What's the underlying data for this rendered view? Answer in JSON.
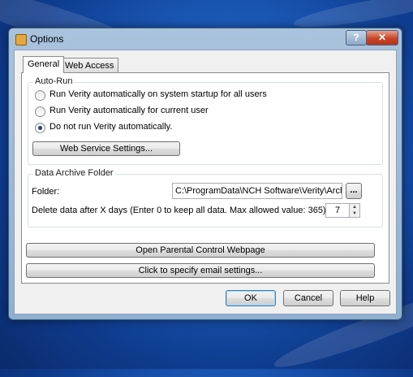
{
  "window": {
    "title": "Options",
    "help_label": "?",
    "close_label": "✕"
  },
  "tabs": [
    {
      "label": "General"
    },
    {
      "label": "Web Access"
    }
  ],
  "auto_run": {
    "title": "Auto-Run",
    "options": [
      {
        "label": "Run Verity automatically on system startup for all users",
        "checked": false
      },
      {
        "label": "Run Verity automatically for current user",
        "checked": false
      },
      {
        "label": "Do not run Verity automatically.",
        "checked": true
      }
    ],
    "web_service_button": "Web Service Settings..."
  },
  "archive": {
    "title": "Data Archive Folder",
    "folder_label": "Folder:",
    "folder_value": "C:\\ProgramData\\NCH Software\\Verity\\Archive",
    "browse_label": "...",
    "delete_label": "Delete data after X days (Enter 0 to keep all data. Max allowed value: 365):",
    "delete_value": "7"
  },
  "actions": {
    "parental_button": "Open Parental Control Webpage",
    "email_button": "Click to specify email settings..."
  },
  "footer": {
    "ok": "OK",
    "cancel": "Cancel",
    "help": "Help"
  }
}
